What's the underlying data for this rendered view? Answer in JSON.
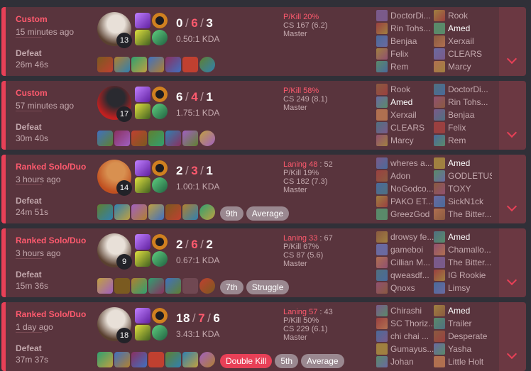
{
  "colors": {
    "loss_accent": "#e84057",
    "card_bg": "#59343d"
  },
  "matches": [
    {
      "mode": "Custom",
      "time_ago": "15 minutes ago",
      "result": "Defeat",
      "duration": "26m 46s",
      "champion_level": "13",
      "kda": {
        "kills": "0",
        "deaths": "6",
        "assists": "3",
        "ratio": "0.50:1 KDA"
      },
      "stats": {
        "laning": null,
        "pkill": "P/Kill 20%",
        "cs": "CS 167 (6.2)",
        "rank": "Master"
      },
      "badges": [],
      "team1": [
        "DoctorDi...",
        "Rin Tohs...",
        "Benjaa",
        "Felix",
        "Rem"
      ],
      "team2": [
        "Rook",
        "Amed",
        "Xerxail",
        "CLEARS",
        "Marcy"
      ],
      "me_team": 2,
      "me_index": 1
    },
    {
      "mode": "Custom",
      "time_ago": "57 minutes ago",
      "result": "Defeat",
      "duration": "30m 40s",
      "champion_level": "17",
      "kda": {
        "kills": "6",
        "deaths": "4",
        "assists": "1",
        "ratio": "1.75:1 KDA"
      },
      "stats": {
        "laning": null,
        "pkill": "P/Kill 58%",
        "cs": "CS 249 (8.1)",
        "rank": "Master"
      },
      "badges": [],
      "team1": [
        "Rook",
        "Amed",
        "Xerxail",
        "CLEARS",
        "Marcy"
      ],
      "team2": [
        "DoctorDi...",
        "Rin Tohs...",
        "Benjaa",
        "Felix",
        "Rem"
      ],
      "me_team": 1,
      "me_index": 1
    },
    {
      "mode": "Ranked Solo/Duo",
      "time_ago": "3 hours ago",
      "result": "Defeat",
      "duration": "24m 51s",
      "champion_level": "14",
      "kda": {
        "kills": "2",
        "deaths": "3",
        "assists": "1",
        "ratio": "1.00:1 KDA"
      },
      "stats": {
        "laning": {
          "label": "Laning",
          "a": "48",
          "sep": " : ",
          "b": "52"
        },
        "pkill": "P/Kill 19%",
        "cs": "CS 182 (7.3)",
        "rank": "Master"
      },
      "badges": [
        {
          "text": "9th",
          "style": "grey"
        },
        {
          "text": "Average",
          "style": "grey"
        }
      ],
      "team1": [
        "wheres a...",
        "Adon",
        "NoGodco...",
        "PAKO ET...",
        "GreezGod"
      ],
      "team2": [
        "Amed",
        "GODLETUS",
        "TOXY",
        "SickN1ck",
        "The Bitter..."
      ],
      "me_team": 2,
      "me_index": 0
    },
    {
      "mode": "Ranked Solo/Duo",
      "time_ago": "3 hours ago",
      "result": "Defeat",
      "duration": "15m 36s",
      "champion_level": "9",
      "kda": {
        "kills": "2",
        "deaths": "6",
        "assists": "2",
        "ratio": "0.67:1 KDA"
      },
      "stats": {
        "laning": {
          "label": "Laning",
          "a": "33",
          "sep": " : ",
          "b": "67"
        },
        "pkill": "P/Kill 67%",
        "cs": "CS 87 (5.6)",
        "rank": "Master"
      },
      "badges": [
        {
          "text": "7th",
          "style": "grey"
        },
        {
          "text": "Struggle",
          "style": "grey"
        }
      ],
      "team1": [
        "drowsy fe...",
        "gameboi",
        "Cillian M...",
        "qweasdf...",
        "Qnoxs"
      ],
      "team2": [
        "Amed",
        "Chamallo...",
        "The Bitter...",
        "IG Rookie",
        "Limsy"
      ],
      "me_team": 2,
      "me_index": 0
    },
    {
      "mode": "Ranked Solo/Duo",
      "time_ago": "1 day ago",
      "result": "Defeat",
      "duration": "37m 37s",
      "champion_level": "18",
      "kda": {
        "kills": "18",
        "deaths": "7",
        "assists": "6",
        "ratio": "3.43:1 KDA"
      },
      "stats": {
        "laning": {
          "label": "Laning",
          "a": "57",
          "sep": " : ",
          "b": "43"
        },
        "pkill": "P/Kill 50%",
        "cs": "CS 229 (6.1)",
        "rank": "Master"
      },
      "badges": [
        {
          "text": "Double Kill",
          "style": "red"
        },
        {
          "text": "5th",
          "style": "grey"
        },
        {
          "text": "Average",
          "style": "grey"
        }
      ],
      "team1": [
        "Chirashi",
        "SC Thoriz...",
        "chi chai ...",
        "Gumayus...",
        "Johan"
      ],
      "team2": [
        "Amed",
        "Trailer",
        "Desperate",
        "Yasha",
        "Little Holt"
      ],
      "me_team": 2,
      "me_index": 0
    }
  ]
}
